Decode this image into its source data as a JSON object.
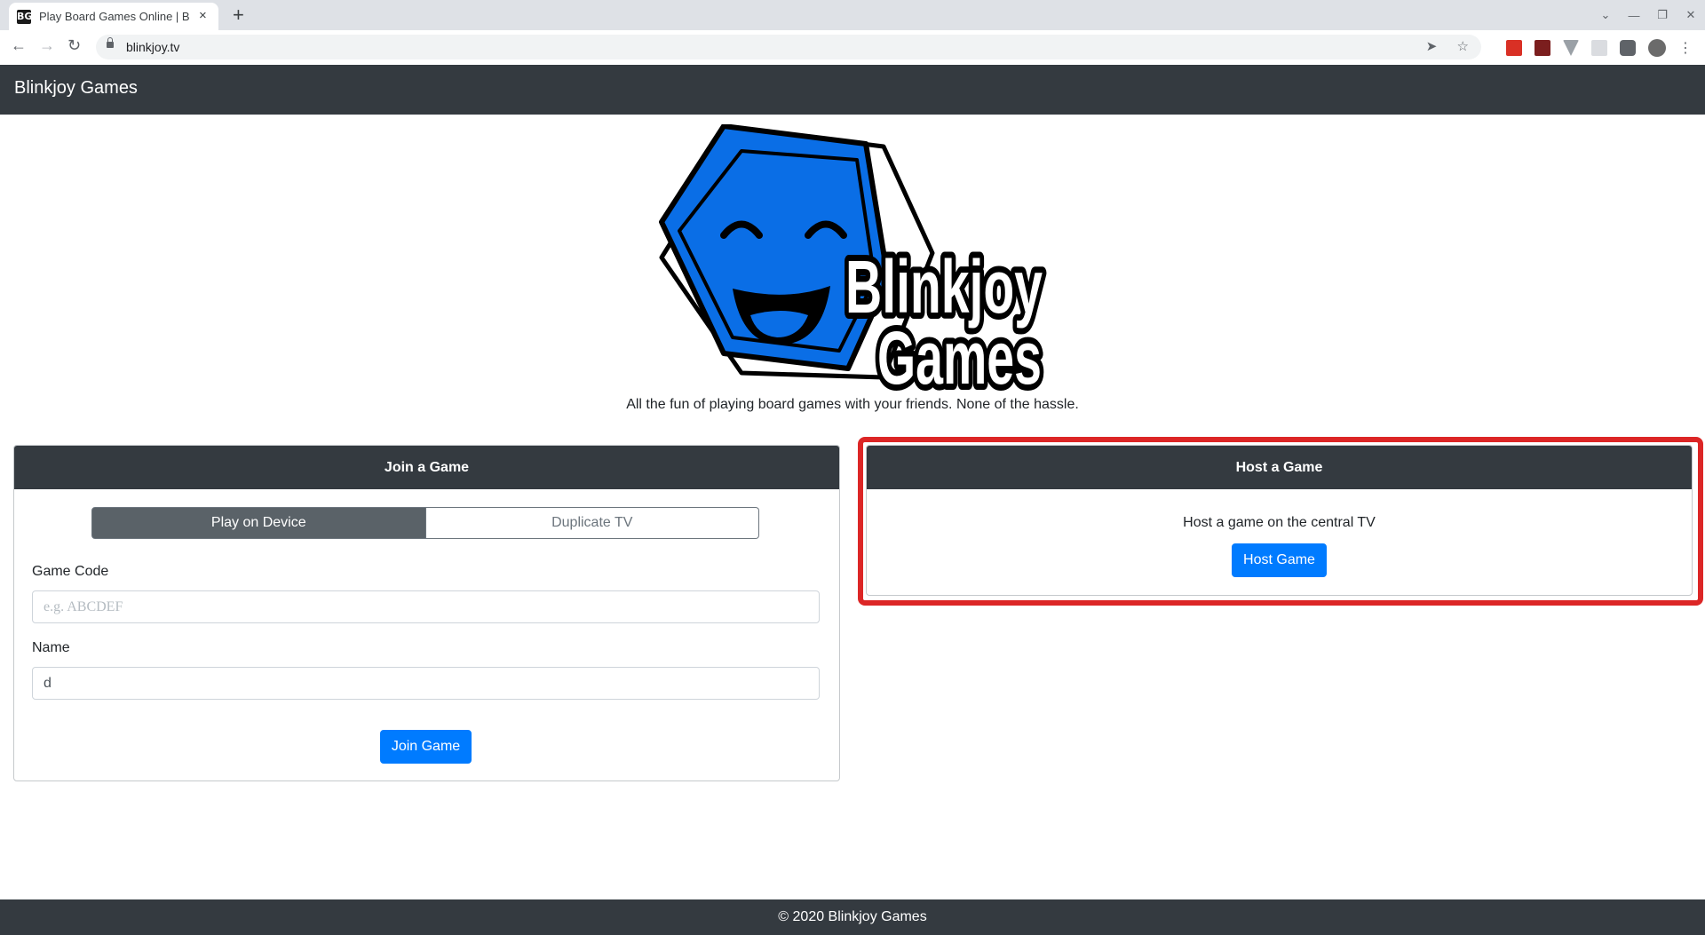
{
  "browser": {
    "tab_title": "Play Board Games Online | Blinkjoy Games",
    "favicon_text": "BG",
    "close_icon": "×",
    "new_tab_icon": "+",
    "url": "blinkjoy.tv",
    "window_controls": [
      "⌄",
      "—",
      "❐",
      "✕"
    ]
  },
  "navbar": {
    "brand": "Blinkjoy Games"
  },
  "hero": {
    "logo_line1": "Blinkjoy",
    "logo_line2": "Games",
    "tagline": "All the fun of playing board games with your friends. None of the hassle."
  },
  "join": {
    "title": "Join a Game",
    "mode_active": "Play on Device",
    "mode_inactive": "Duplicate TV",
    "code_label": "Game Code",
    "code_placeholder": "e.g. ABCDEF",
    "name_label": "Name",
    "name_value": "d",
    "button": "Join Game"
  },
  "host": {
    "title": "Host a Game",
    "description": "Host a game on the central TV",
    "button": "Host Game"
  },
  "footer": {
    "text": "© 2020 Blinkjoy Games"
  },
  "colors": {
    "navbar": "#343a40",
    "primary": "#007bff",
    "logo_blue": "#0a6ee6",
    "highlight": "#dc2626"
  }
}
